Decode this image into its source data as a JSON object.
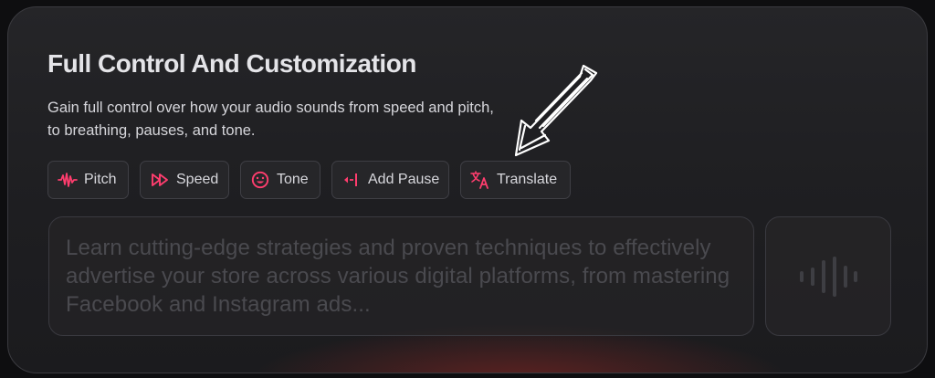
{
  "section": {
    "title": "Full Control And Customization",
    "description": "Gain full control over how your audio sounds from speed and pitch, to breathing, pauses, and tone."
  },
  "toolbar": {
    "buttons": [
      {
        "label": "Pitch",
        "icon": "waveform-icon"
      },
      {
        "label": "Speed",
        "icon": "fast-forward-icon"
      },
      {
        "label": "Tone",
        "icon": "smiley-icon"
      },
      {
        "label": "Add Pause",
        "icon": "pause-marker-icon"
      },
      {
        "label": "Translate",
        "icon": "translate-icon"
      }
    ]
  },
  "editor": {
    "placeholder": "Learn cutting-edge strategies and proven techniques to effectively advertise your store across various digital platforms, from mastering Facebook and Instagram ads..."
  },
  "voice_button": {
    "icon": "audio-wave-icon"
  },
  "colors": {
    "accent": "#ff3d6e",
    "accent_alt": "#e8356a",
    "card_bg": "#232326",
    "border": "#3a3a40"
  }
}
